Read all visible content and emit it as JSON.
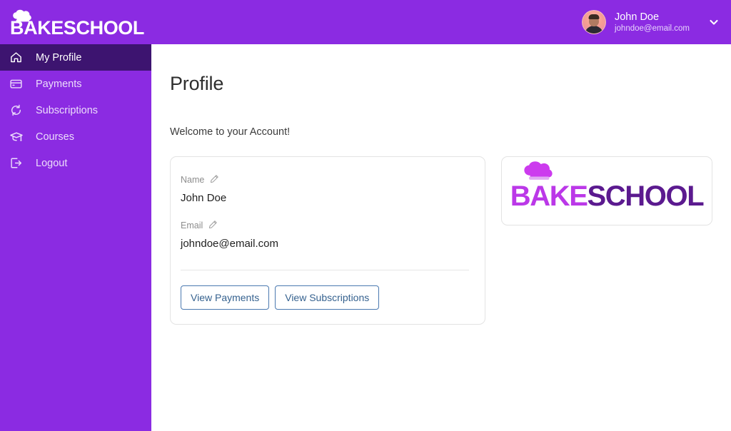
{
  "brand": {
    "name": "BAKESCHOOL",
    "hat_icon": "chef-hat-icon"
  },
  "header": {
    "user": {
      "name": "John Doe",
      "email": "johndoe@email.com",
      "avatar_icon": "user-avatar",
      "chevron_icon": "chevron-down-icon"
    },
    "background_color": "#8b2be2"
  },
  "sidebar": {
    "background_color": "#8b2be2",
    "active_color": "#3d1470",
    "items": [
      {
        "label": "My Profile",
        "icon": "home-icon",
        "active": true
      },
      {
        "label": "Payments",
        "icon": "credit-card-icon",
        "active": false
      },
      {
        "label": "Subscriptions",
        "icon": "refresh-cycle-icon",
        "active": false
      },
      {
        "label": "Courses",
        "icon": "graduation-cap-icon",
        "active": false
      },
      {
        "label": "Logout",
        "icon": "logout-icon",
        "active": false
      }
    ]
  },
  "main": {
    "page_title": "Profile",
    "welcome_text": "Welcome to your Account!",
    "profile_card": {
      "fields": [
        {
          "label": "Name",
          "value": "John Doe",
          "edit_icon": "pencil-icon"
        },
        {
          "label": "Email",
          "value": "johndoe@email.com",
          "edit_icon": "pencil-icon"
        }
      ],
      "buttons": [
        {
          "label": "View Payments"
        },
        {
          "label": "View Subscriptions"
        }
      ],
      "button_color": "#36628f",
      "button_border_color": "#4b79b0"
    },
    "logo_card": {
      "text_part_1": "BAKE",
      "text_part_2": "SCHOOL",
      "color_part_1": "#bb38e8",
      "color_part_2": "#5b1a8f",
      "hat_icon": "chef-hat-icon"
    }
  }
}
